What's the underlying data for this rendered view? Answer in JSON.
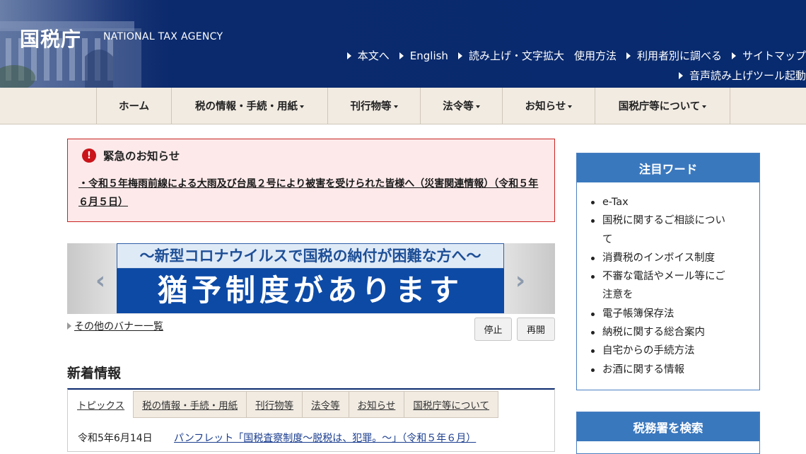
{
  "header": {
    "logo": "国税庁",
    "logo_en": "NATIONAL TAX AGENCY",
    "util_links": [
      "本文へ",
      "English",
      "読み上げ・文字拡大",
      "使用方法",
      "利用者別に調べる",
      "サイトマップ"
    ],
    "util_links_2": [
      "音声読み上げツール起動"
    ]
  },
  "gnav": {
    "items": [
      {
        "label": "ホーム",
        "dropdown": false
      },
      {
        "label": "税の情報・手続・用紙",
        "dropdown": true
      },
      {
        "label": "刊行物等",
        "dropdown": true
      },
      {
        "label": "法令等",
        "dropdown": true
      },
      {
        "label": "お知らせ",
        "dropdown": true
      },
      {
        "label": "国税庁等について",
        "dropdown": true
      }
    ]
  },
  "emergency": {
    "icon": "!",
    "title": "緊急のお知らせ",
    "link": "・令和５年梅雨前線による大雨及び台風２号により被害を受けられた皆様へ（災害関連情報）（令和５年６月５日）"
  },
  "banner": {
    "top": "～新型コロナウイルスで国税の納付が困難な方へ～",
    "main": "猶予制度があります",
    "prev": "‹",
    "next": "›",
    "other_link": "その他のバナー一覧",
    "stop": "停止",
    "resume": "再開"
  },
  "news": {
    "title": "新着情報",
    "tabs": [
      "トピックス",
      "税の情報・手続・用紙",
      "刊行物等",
      "法令等",
      "お知らせ",
      "国税庁等について"
    ],
    "items": [
      {
        "date": "令和5年6月14日",
        "text": "パンフレット「国税査察制度～脱税は、犯罪。～」（令和５年６月）"
      }
    ]
  },
  "side": {
    "featured_title": "注目ワード",
    "featured": [
      "e-Tax",
      "国税に関するご相談について",
      "消費税のインボイス制度",
      "不審な電話やメール等にご注意を",
      "電子帳簿保存法",
      "納税に関する総合案内",
      "自宅からの手続方法",
      "お酒に関する情報"
    ],
    "search_title": "税務署を検索"
  },
  "colors": {
    "header_bg": "#082a6e",
    "nav_bg": "#f1ebe2",
    "emergency_bg": "#fde9ea",
    "emergency_border": "#c9231f",
    "side_head": "#3a78be",
    "banner_main": "#0d4aa6"
  }
}
